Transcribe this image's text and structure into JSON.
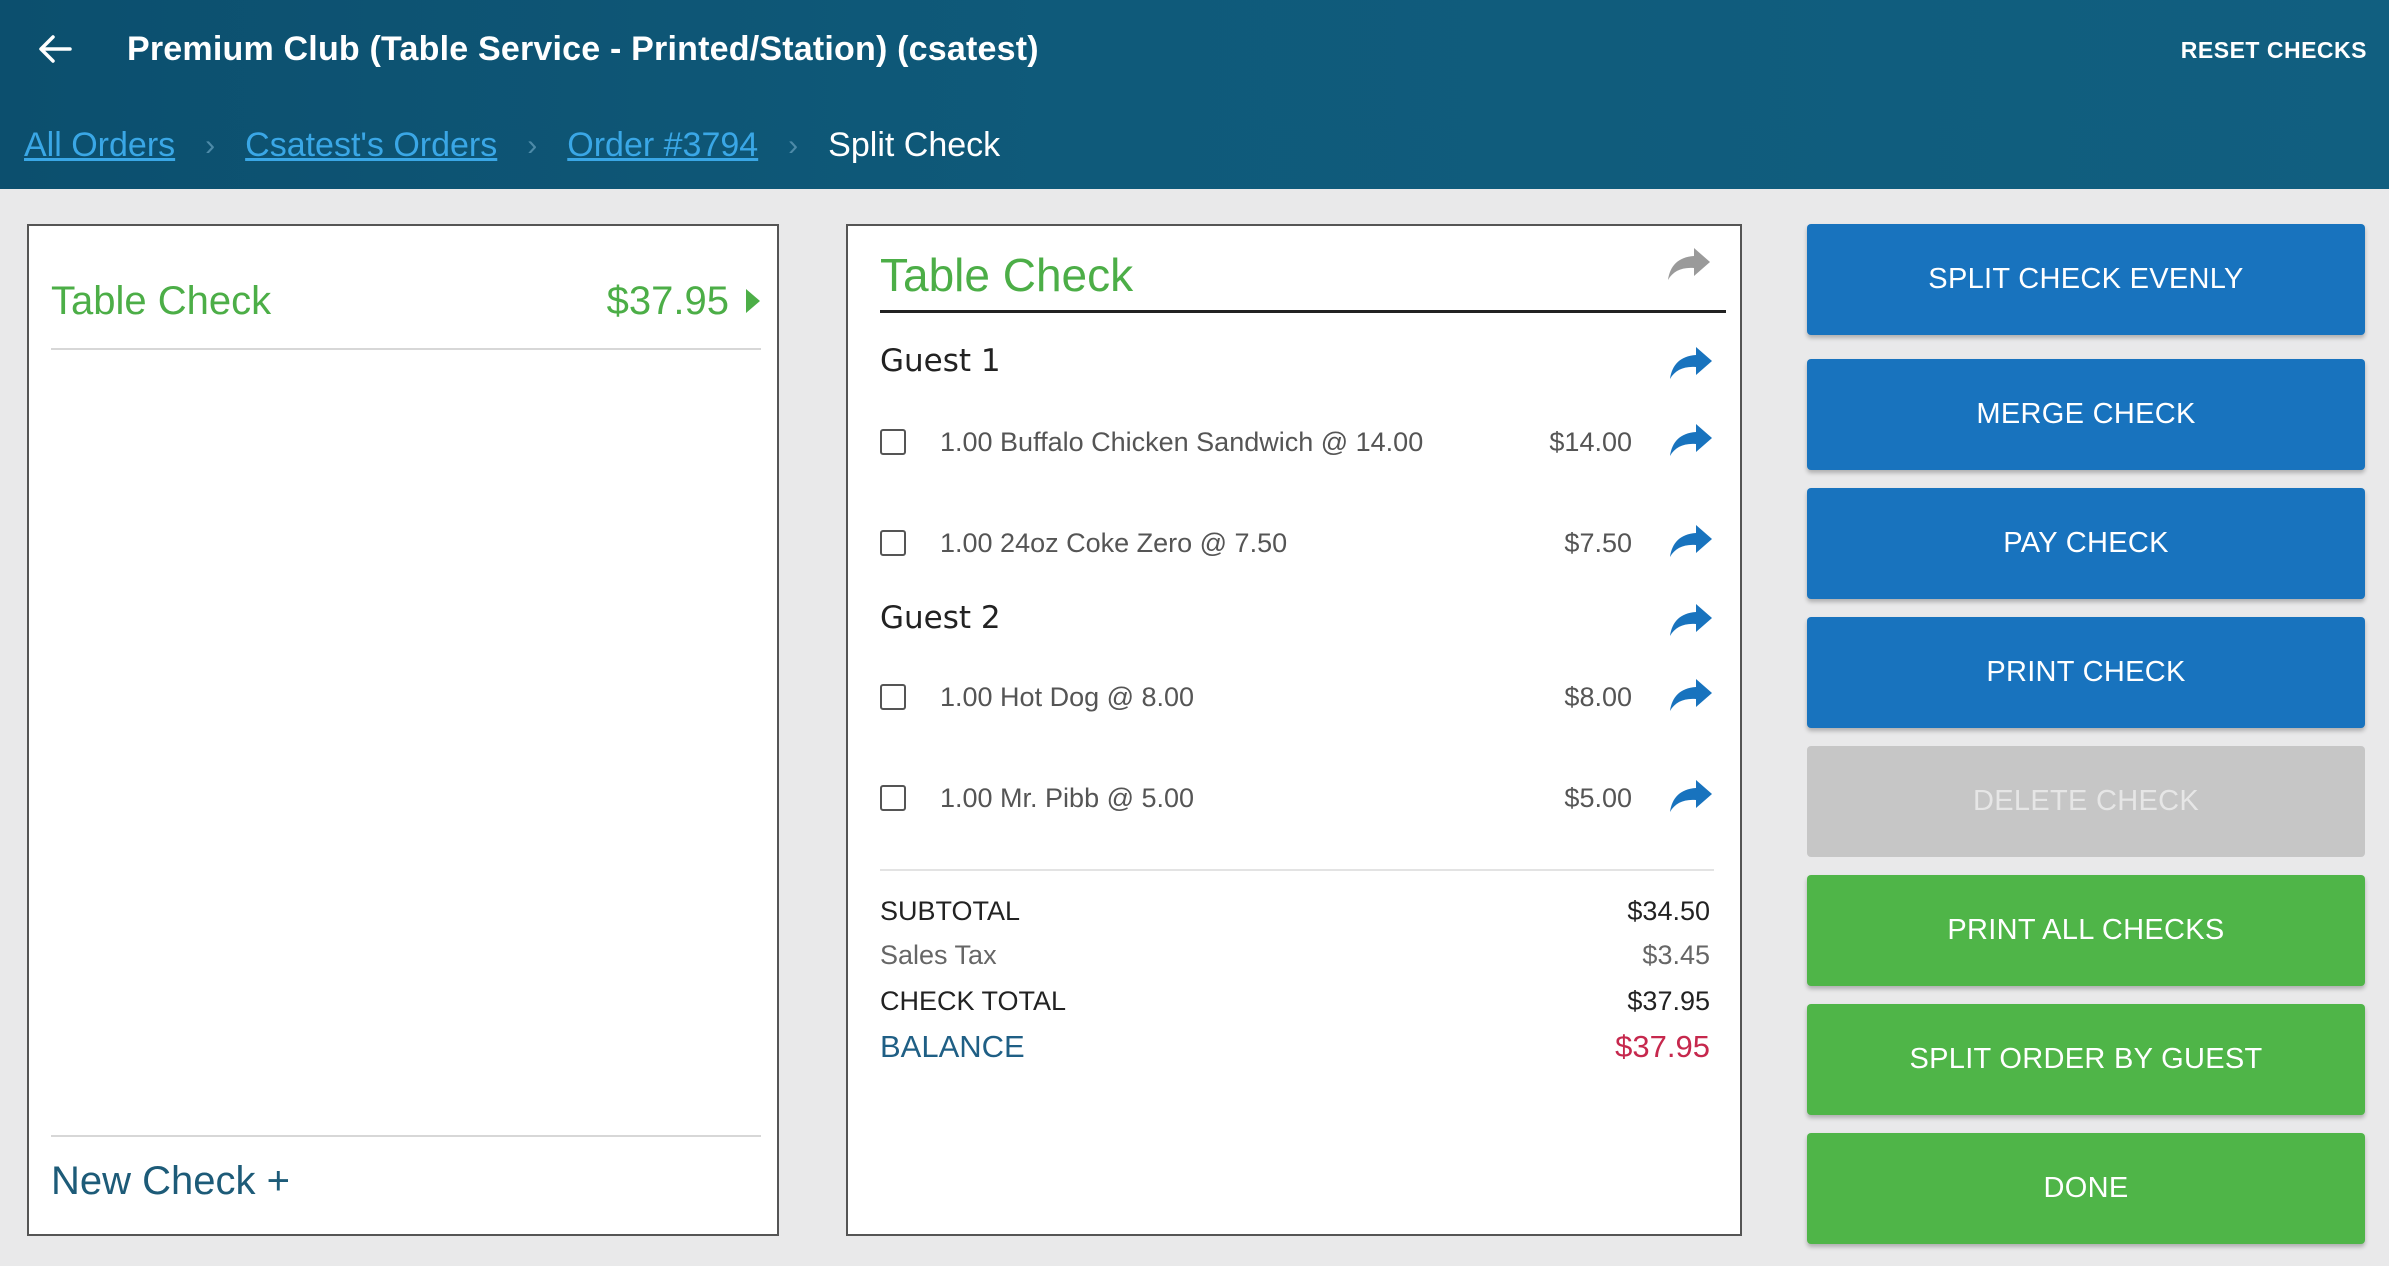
{
  "header": {
    "title": "Premium Club (Table Service - Printed/Station) (csatest)",
    "reset_label": "RESET CHECKS"
  },
  "breadcrumb": {
    "items": [
      {
        "label": "All Orders"
      },
      {
        "label": "Csatest's Orders"
      },
      {
        "label": "Order #3794"
      }
    ],
    "current": "Split Check"
  },
  "checks": {
    "items": [
      {
        "name": "Table Check",
        "amount": "$37.95"
      }
    ],
    "new_check_label": "New Check +"
  },
  "detail": {
    "title": "Table Check",
    "guests": [
      {
        "label": "Guest 1",
        "items": [
          {
            "name": "1.00 Buffalo Chicken Sandwich @  14.00",
            "price": "$14.00"
          },
          {
            "name": "1.00 24oz Coke Zero @  7.50",
            "price": "$7.50"
          }
        ]
      },
      {
        "label": "Guest 2",
        "items": [
          {
            "name": "1.00 Hot Dog @  8.00",
            "price": "$8.00"
          },
          {
            "name": "1.00 Mr. Pibb @  5.00",
            "price": "$5.00"
          }
        ]
      }
    ],
    "totals": {
      "subtotal_label": "SUBTOTAL",
      "subtotal": "$34.50",
      "tax_label": "Sales Tax",
      "tax": "$3.45",
      "total_label": "CHECK TOTAL",
      "total": "$37.95",
      "balance_label": "BALANCE",
      "balance": "$37.95"
    }
  },
  "actions": {
    "split_evenly": "SPLIT CHECK EVENLY",
    "merge": "MERGE CHECK",
    "pay": "PAY CHECK",
    "print": "PRINT CHECK",
    "delete": "DELETE CHECK",
    "print_all": "PRINT ALL CHECKS",
    "split_by_guest": "SPLIT ORDER BY GUEST",
    "done": "DONE"
  },
  "colors": {
    "header_bg": "#0f5a7a",
    "accent_green": "#4cae47",
    "button_blue": "#1873be",
    "button_green": "#4fb548",
    "balance_red": "#c6284d"
  }
}
